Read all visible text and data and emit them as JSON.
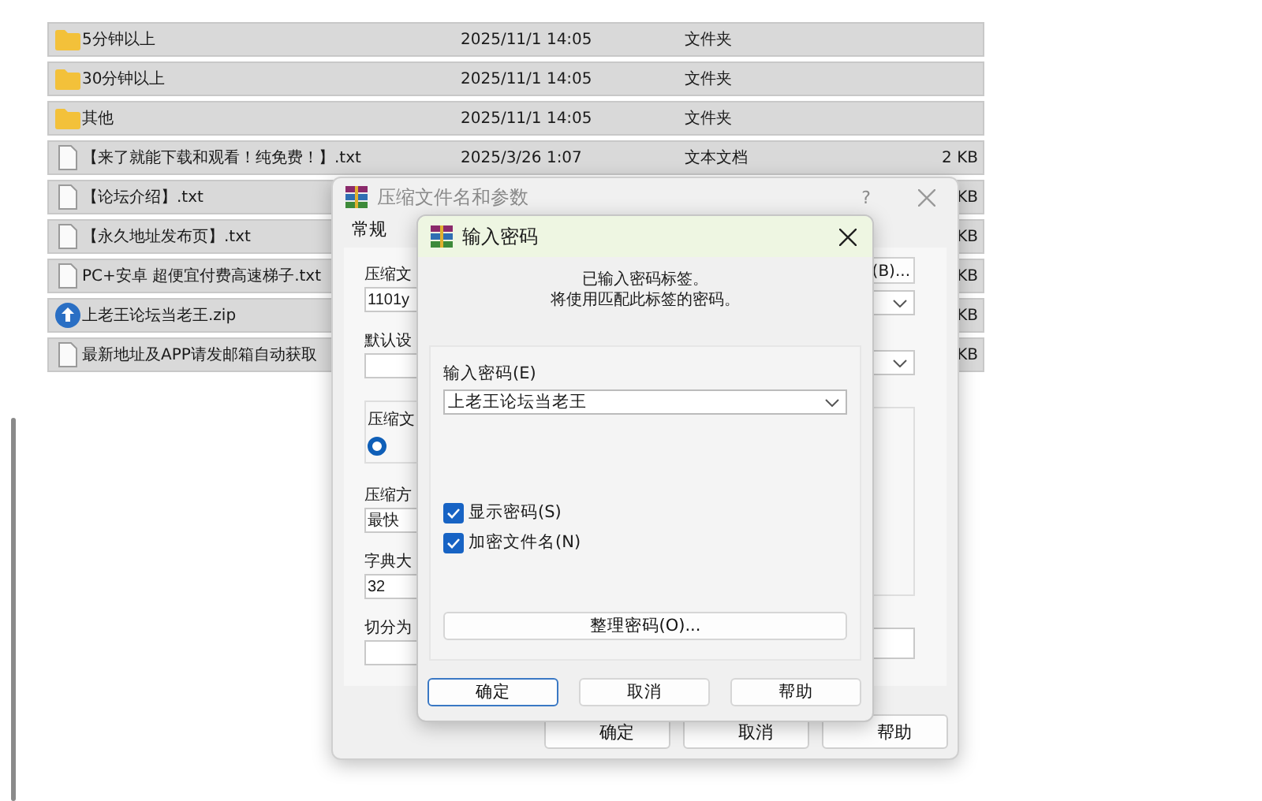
{
  "file_list": {
    "rows": [
      {
        "kind": "folder",
        "name": "5分钟以上",
        "modified": "2025/11/1 14:05",
        "type": "文件夹"
      },
      {
        "kind": "folder",
        "name": "30分钟以上",
        "modified": "2025/11/1 14:05",
        "type": "文件夹"
      },
      {
        "kind": "folder",
        "name": "其他",
        "modified": "2025/11/1 14:05",
        "type": "文件夹"
      },
      {
        "kind": "text",
        "name": "【来了就能下载和观看！纯免费！】.txt",
        "modified": "2025/3/26 1:07",
        "type": "文本文档",
        "size": "2 KB"
      },
      {
        "kind": "text",
        "name": "【论坛介绍】.txt",
        "size": "KB"
      },
      {
        "kind": "text",
        "name": "【永久地址发布页】.txt",
        "size": "KB"
      },
      {
        "kind": "text",
        "name": "PC+安卓 超便宜付费高速梯子.txt",
        "size": "KB"
      },
      {
        "kind": "zip",
        "name": "上老王论坛当老王.zip",
        "size": "KB"
      },
      {
        "kind": "text",
        "name": "最新地址及APP请发邮箱自动获取",
        "size": "KB"
      }
    ]
  },
  "archive_dialog": {
    "title": "压缩文件名和参数",
    "help": "?",
    "tabs": [
      {
        "label": "常规",
        "selected": true
      }
    ],
    "archive_label": "压缩文",
    "archive_name": "1101y",
    "browse_button": "(B)...",
    "profile_label": "默认设",
    "group_label": "压缩文",
    "radio": {
      "checked": true
    },
    "method_label": "压缩方",
    "method": "最快",
    "dict_label": "字典大",
    "dict": "32",
    "split_label": "切分为",
    "buttons": [
      "确定",
      "取消",
      "帮助"
    ]
  },
  "password_dialog": {
    "title": "输入密码",
    "message": [
      "已输入密码标签。",
      "将使用匹配此标签的密码。"
    ],
    "password_label": "输入密码(E)",
    "password": "上老王论坛当老王",
    "options": [
      {
        "label": "显示密码(S)",
        "checked": true
      },
      {
        "label": "加密文件名(N)",
        "checked": true
      }
    ],
    "organize_button": "整理密码(O)...",
    "buttons": [
      {
        "label": "确定",
        "focused": true
      },
      {
        "label": "取消",
        "focused": false
      },
      {
        "label": "帮助",
        "focused": false
      }
    ]
  }
}
